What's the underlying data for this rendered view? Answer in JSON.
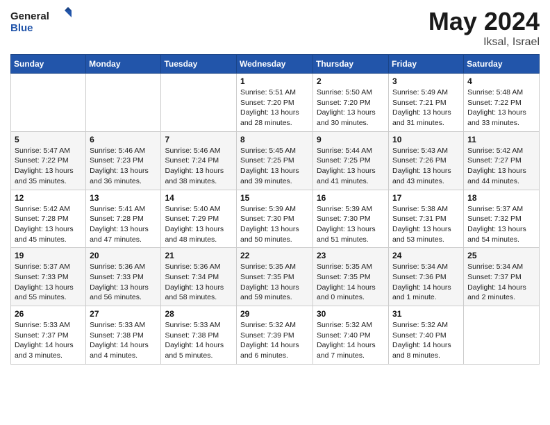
{
  "header": {
    "logo_line1": "General",
    "logo_line2": "Blue",
    "month": "May 2024",
    "location": "Iksal, Israel"
  },
  "weekdays": [
    "Sunday",
    "Monday",
    "Tuesday",
    "Wednesday",
    "Thursday",
    "Friday",
    "Saturday"
  ],
  "weeks": [
    [
      {
        "day": "",
        "info": ""
      },
      {
        "day": "",
        "info": ""
      },
      {
        "day": "",
        "info": ""
      },
      {
        "day": "1",
        "info": "Sunrise: 5:51 AM\nSunset: 7:20 PM\nDaylight: 13 hours\nand 28 minutes."
      },
      {
        "day": "2",
        "info": "Sunrise: 5:50 AM\nSunset: 7:20 PM\nDaylight: 13 hours\nand 30 minutes."
      },
      {
        "day": "3",
        "info": "Sunrise: 5:49 AM\nSunset: 7:21 PM\nDaylight: 13 hours\nand 31 minutes."
      },
      {
        "day": "4",
        "info": "Sunrise: 5:48 AM\nSunset: 7:22 PM\nDaylight: 13 hours\nand 33 minutes."
      }
    ],
    [
      {
        "day": "5",
        "info": "Sunrise: 5:47 AM\nSunset: 7:22 PM\nDaylight: 13 hours\nand 35 minutes."
      },
      {
        "day": "6",
        "info": "Sunrise: 5:46 AM\nSunset: 7:23 PM\nDaylight: 13 hours\nand 36 minutes."
      },
      {
        "day": "7",
        "info": "Sunrise: 5:46 AM\nSunset: 7:24 PM\nDaylight: 13 hours\nand 38 minutes."
      },
      {
        "day": "8",
        "info": "Sunrise: 5:45 AM\nSunset: 7:25 PM\nDaylight: 13 hours\nand 39 minutes."
      },
      {
        "day": "9",
        "info": "Sunrise: 5:44 AM\nSunset: 7:25 PM\nDaylight: 13 hours\nand 41 minutes."
      },
      {
        "day": "10",
        "info": "Sunrise: 5:43 AM\nSunset: 7:26 PM\nDaylight: 13 hours\nand 43 minutes."
      },
      {
        "day": "11",
        "info": "Sunrise: 5:42 AM\nSunset: 7:27 PM\nDaylight: 13 hours\nand 44 minutes."
      }
    ],
    [
      {
        "day": "12",
        "info": "Sunrise: 5:42 AM\nSunset: 7:28 PM\nDaylight: 13 hours\nand 45 minutes."
      },
      {
        "day": "13",
        "info": "Sunrise: 5:41 AM\nSunset: 7:28 PM\nDaylight: 13 hours\nand 47 minutes."
      },
      {
        "day": "14",
        "info": "Sunrise: 5:40 AM\nSunset: 7:29 PM\nDaylight: 13 hours\nand 48 minutes."
      },
      {
        "day": "15",
        "info": "Sunrise: 5:39 AM\nSunset: 7:30 PM\nDaylight: 13 hours\nand 50 minutes."
      },
      {
        "day": "16",
        "info": "Sunrise: 5:39 AM\nSunset: 7:30 PM\nDaylight: 13 hours\nand 51 minutes."
      },
      {
        "day": "17",
        "info": "Sunrise: 5:38 AM\nSunset: 7:31 PM\nDaylight: 13 hours\nand 53 minutes."
      },
      {
        "day": "18",
        "info": "Sunrise: 5:37 AM\nSunset: 7:32 PM\nDaylight: 13 hours\nand 54 minutes."
      }
    ],
    [
      {
        "day": "19",
        "info": "Sunrise: 5:37 AM\nSunset: 7:33 PM\nDaylight: 13 hours\nand 55 minutes."
      },
      {
        "day": "20",
        "info": "Sunrise: 5:36 AM\nSunset: 7:33 PM\nDaylight: 13 hours\nand 56 minutes."
      },
      {
        "day": "21",
        "info": "Sunrise: 5:36 AM\nSunset: 7:34 PM\nDaylight: 13 hours\nand 58 minutes."
      },
      {
        "day": "22",
        "info": "Sunrise: 5:35 AM\nSunset: 7:35 PM\nDaylight: 13 hours\nand 59 minutes."
      },
      {
        "day": "23",
        "info": "Sunrise: 5:35 AM\nSunset: 7:35 PM\nDaylight: 14 hours\nand 0 minutes."
      },
      {
        "day": "24",
        "info": "Sunrise: 5:34 AM\nSunset: 7:36 PM\nDaylight: 14 hours\nand 1 minute."
      },
      {
        "day": "25",
        "info": "Sunrise: 5:34 AM\nSunset: 7:37 PM\nDaylight: 14 hours\nand 2 minutes."
      }
    ],
    [
      {
        "day": "26",
        "info": "Sunrise: 5:33 AM\nSunset: 7:37 PM\nDaylight: 14 hours\nand 3 minutes."
      },
      {
        "day": "27",
        "info": "Sunrise: 5:33 AM\nSunset: 7:38 PM\nDaylight: 14 hours\nand 4 minutes."
      },
      {
        "day": "28",
        "info": "Sunrise: 5:33 AM\nSunset: 7:38 PM\nDaylight: 14 hours\nand 5 minutes."
      },
      {
        "day": "29",
        "info": "Sunrise: 5:32 AM\nSunset: 7:39 PM\nDaylight: 14 hours\nand 6 minutes."
      },
      {
        "day": "30",
        "info": "Sunrise: 5:32 AM\nSunset: 7:40 PM\nDaylight: 14 hours\nand 7 minutes."
      },
      {
        "day": "31",
        "info": "Sunrise: 5:32 AM\nSunset: 7:40 PM\nDaylight: 14 hours\nand 8 minutes."
      },
      {
        "day": "",
        "info": ""
      }
    ]
  ]
}
